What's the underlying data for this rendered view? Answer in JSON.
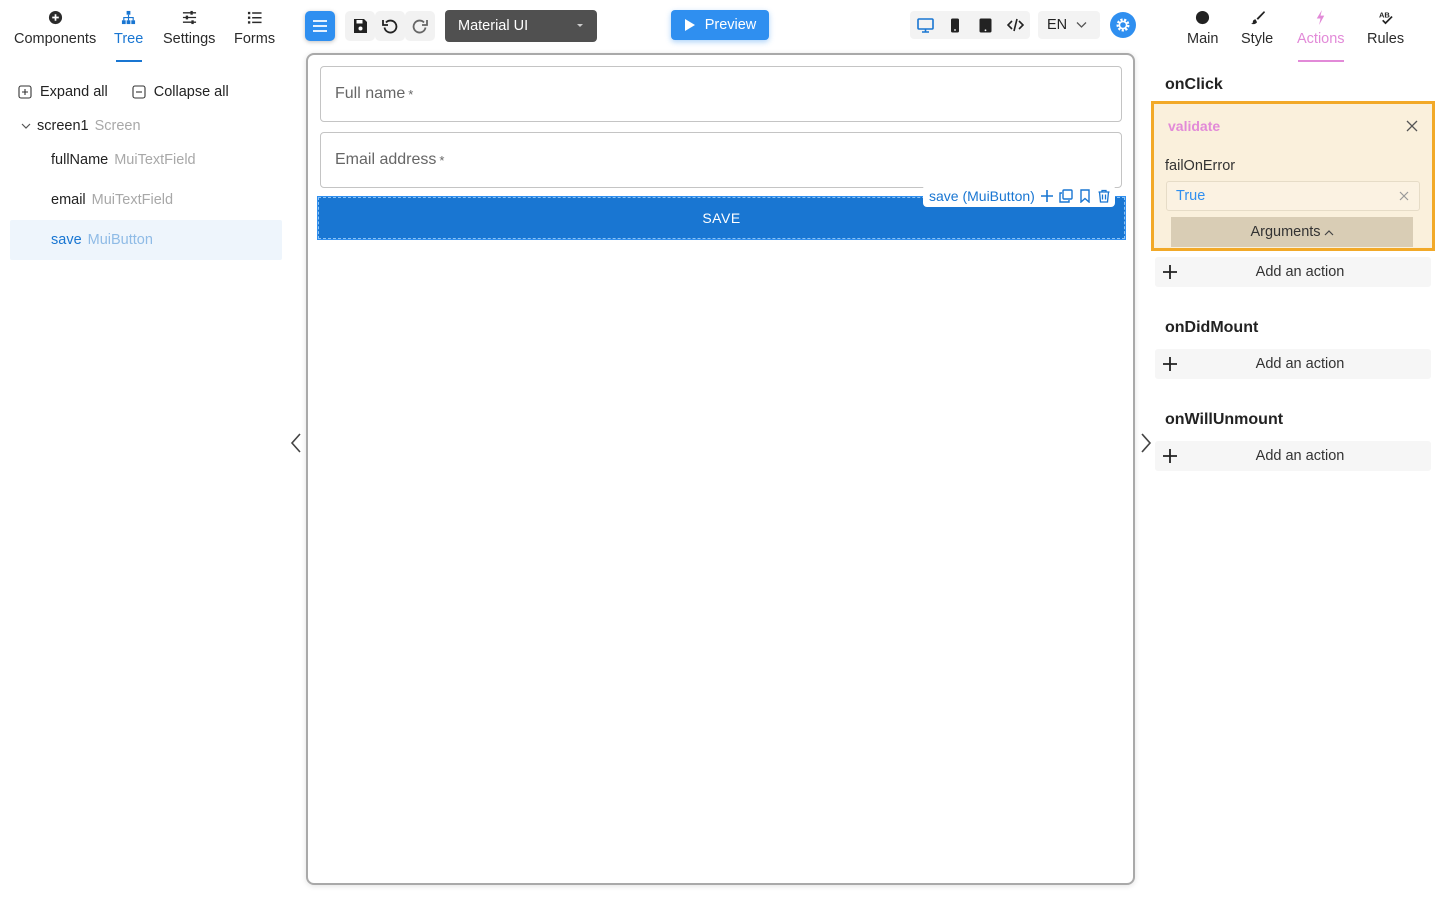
{
  "left_tabs": [
    {
      "label": "Components",
      "icon": "plus-circle-icon"
    },
    {
      "label": "Tree",
      "icon": "hierarchy-icon"
    },
    {
      "label": "Settings",
      "icon": "sliders-icon"
    },
    {
      "label": "Forms",
      "icon": "list-icon"
    }
  ],
  "tree_actions": {
    "expand_all": "Expand all",
    "collapse_all": "Collapse all"
  },
  "tree": {
    "root": {
      "name": "screen1",
      "type": "Screen"
    },
    "children": [
      {
        "name": "fullName",
        "type": "MuiTextField"
      },
      {
        "name": "email",
        "type": "MuiTextField"
      },
      {
        "name": "save",
        "type": "MuiButton"
      }
    ]
  },
  "toolbar": {
    "theme": "Material UI",
    "preview": "Preview",
    "language": "EN"
  },
  "canvas": {
    "fields": [
      {
        "label": "Full name",
        "required_mark": "*"
      },
      {
        "label": "Email address",
        "required_mark": "*"
      }
    ],
    "button_label": "SAVE",
    "selection_label": "save (MuiButton)"
  },
  "right_tabs": [
    {
      "label": "Main",
      "icon": "circle-icon"
    },
    {
      "label": "Style",
      "icon": "brush-icon"
    },
    {
      "label": "Actions",
      "icon": "lightning-icon"
    },
    {
      "label": "Rules",
      "icon": "ab-check-icon"
    }
  ],
  "events": {
    "on_click": "onClick",
    "on_did_mount": "onDidMount",
    "on_will_unmount": "onWillUnmount"
  },
  "action_card": {
    "name": "validate",
    "param_label": "failOnError",
    "param_value": "True",
    "arguments_label": "Arguments"
  },
  "add_action_label": "Add an action",
  "colors": {
    "accent": "#1976d2",
    "button_blue": "#2f8ff0",
    "actions_pink": "#e28ad8",
    "card_border": "#f2a928",
    "card_bg": "#faf0dc"
  }
}
